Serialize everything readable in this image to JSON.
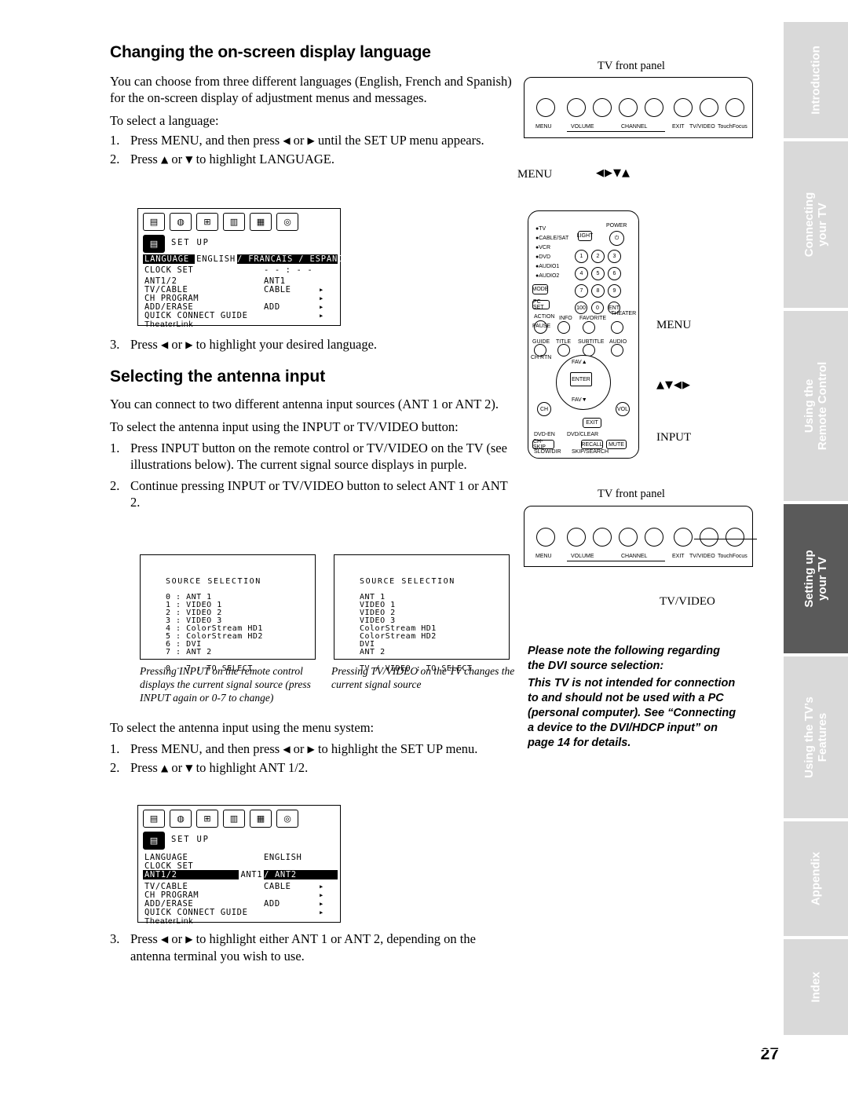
{
  "page_number": "27",
  "section1": {
    "title": "Changing the on-screen display language",
    "intro": "You can choose from three different languages (English, French and Spanish) for the on-screen display of adjustment menus and messages.",
    "intro2": "To select a language:",
    "steps": [
      {
        "n": "1.",
        "pre": "Press MENU, and then press ",
        "a1": "◀",
        "mid": "or",
        "a2": "▶",
        "post": " until the SET UP menu appears."
      },
      {
        "n": "2.",
        "pre": "Press ",
        "a1": "▲",
        "mid": "or",
        "a2": "▼",
        "post": " to highlight LANGUAGE."
      },
      {
        "n": "3.",
        "pre": "Press ",
        "a1": "◀",
        "mid": "or",
        "a2": "▶",
        "post": " to highlight your desired language."
      }
    ]
  },
  "section2": {
    "title": "Selecting the antenna input",
    "intro": "You can connect to two different antenna input sources (ANT 1 or ANT 2).",
    "intro2": "To select the antenna input using the INPUT or TV/VIDEO button:",
    "steps": [
      {
        "n": "1.",
        "text": "Press INPUT button on the remote control or TV/VIDEO on the TV (see illustrations below). The current signal source displays in purple."
      },
      {
        "n": "2.",
        "text": "Continue pressing INPUT or TV/VIDEO button to select ANT 1 or ANT 2."
      }
    ],
    "intro3": "To select the antenna input using the menu system:",
    "steps2": [
      {
        "n": "1.",
        "pre": "Press MENU, and then press ",
        "a1": "◀",
        "mid": "or",
        "a2": "▶",
        "post": " to highlight the SET UP menu."
      },
      {
        "n": "2.",
        "pre": "Press ",
        "a1": "▲",
        "mid": "or",
        "a2": "▼",
        "post": " to highlight ANT 1/2."
      },
      {
        "n": "3.",
        "pre": "Press ",
        "a1": "◀",
        "mid": "or",
        "a2": "▶",
        "post": " to highlight either ANT 1 or ANT 2, depending on the antenna terminal you wish to use."
      }
    ]
  },
  "osd_menu_1": {
    "title": "SET UP",
    "rows": [
      {
        "label": "LANGUAGE",
        "value": "ENGLISH / FRANCAIS / ESPANOL",
        "highlight": true,
        "selected": "ENGLISH"
      },
      {
        "label": "CLOCK SET",
        "value": "- - : - -"
      },
      {
        "label": "ANT1/2",
        "value": "ANT1"
      },
      {
        "label": "TV/CABLE",
        "value": "CABLE",
        "arrow": true
      },
      {
        "label": "CH PROGRAM",
        "value": "",
        "arrow": true
      },
      {
        "label": "ADD/ERASE",
        "value": "ADD",
        "arrow": true
      },
      {
        "label": "QUICK CONNECT GUIDE",
        "value": "",
        "arrow": true
      },
      {
        "label": "TheaterLink",
        "value": "",
        "arrow": true
      }
    ]
  },
  "osd_menu_2": {
    "title": "SET UP",
    "rows": [
      {
        "label": "LANGUAGE",
        "value": "ENGLISH"
      },
      {
        "label": "CLOCK SET",
        "value": ""
      },
      {
        "label": "ANT1/2",
        "value": "ANT1 / ANT2",
        "highlight": true,
        "selected": "ANT1"
      },
      {
        "label": "TV/CABLE",
        "value": "CABLE",
        "arrow": true
      },
      {
        "label": "CH PROGRAM",
        "value": "",
        "arrow": true
      },
      {
        "label": "ADD/ERASE",
        "value": "ADD",
        "arrow": true
      },
      {
        "label": "QUICK CONNECT GUIDE",
        "value": "",
        "arrow": true
      },
      {
        "label": "TheaterLink",
        "value": "",
        "arrow": true
      }
    ]
  },
  "source_box_left": {
    "title": "SOURCE  SELECTION",
    "lines": [
      "0 : ANT 1",
      "1 : VIDEO 1",
      "2 : VIDEO 2",
      "3 : VIDEO 3",
      "4 : ColorStream HD1",
      "5 : ColorStream HD2",
      "6 : DVI",
      "7 : ANT 2"
    ],
    "footer": "0 - 7 : TO SELECT",
    "caption": "Pressing INPUT on the remote control displays the current signal source (press INPUT again or 0-7 to change)"
  },
  "source_box_right": {
    "title": "SOURCE  SELECTION",
    "lines": [
      "ANT 1",
      "VIDEO 1",
      "VIDEO 2",
      "VIDEO 3",
      "ColorStream HD1",
      "ColorStream HD2",
      "DVI",
      "ANT 2"
    ],
    "footer": "TV / VIDEO : TO SELECT",
    "caption": "Pressing TV/VIDEO on the TV changes the current signal source"
  },
  "illustrations": {
    "front_panel_label_top": "TV front panel",
    "front_panel_label_bottom": "TV front panel",
    "front_panel_buttons": [
      "MENU",
      "VOLUME",
      "CHANNEL",
      "EXIT",
      "TV/VIDEO",
      "TouchFocus"
    ],
    "menu_label_top": "MENU",
    "menu_arrows_top": "◀▶▼▲",
    "menu_label_remote": "MENU",
    "arrows_remote": "▲▼◀▶",
    "input_label": "INPUT",
    "tvvideo_label": "TV/VIDEO"
  },
  "remote": {
    "source_buttons": [
      "●TV",
      "●CABLE/SAT",
      "●VCR",
      "●DVD",
      "●AUDIO1",
      "●AUDIO2"
    ],
    "power": "POWER",
    "light": "LIGHT",
    "mode": "MODE",
    "keypad": [
      "1",
      "2",
      "3",
      "4",
      "5",
      "6",
      "7",
      "8",
      "9",
      "100",
      "0",
      "ENT"
    ],
    "pcset": "PC SET",
    "row_action": [
      "ACTION",
      "PAUSE",
      "INFO",
      "FAVORITE",
      "THEATER LINK"
    ],
    "row_guide": [
      "GUIDE",
      "TITLE",
      "SUBTITLE",
      "AUDIO",
      "CH RTN"
    ],
    "fav_up": "FAV▲",
    "fav_dn": "FAV▼",
    "enter": "ENTER",
    "ch": "CH",
    "vol": "VOL",
    "exit": "EXIT",
    "dvd_clear": "DVD/CLEAR",
    "dvd_ren": "DVD-EN",
    "bottom": [
      "CH-SKIP",
      "SLOW/DIR",
      "SKIP/SEARCH",
      "RECALL",
      "MUTE"
    ]
  },
  "note": {
    "lines": [
      "Please note the following regarding",
      "the DVI source selection:",
      "This TV is not intended for connection",
      "to and should not be used with a PC",
      "(personal computer). See “Connecting",
      "a device to the DVI/HDCP input” on",
      "page 14 for details."
    ]
  },
  "side_tabs": [
    {
      "label": "Introduction",
      "style": "light"
    },
    {
      "label": "Connecting\nyour TV",
      "style": "light"
    },
    {
      "label": "Using the\nRemote Control",
      "style": "light"
    },
    {
      "label": "Setting up\nyour TV",
      "style": "dark"
    },
    {
      "label": "Using the TV’s\nFeatures",
      "style": "light"
    },
    {
      "label": "Appendix",
      "style": "light"
    },
    {
      "label": "Index",
      "style": "light"
    }
  ]
}
